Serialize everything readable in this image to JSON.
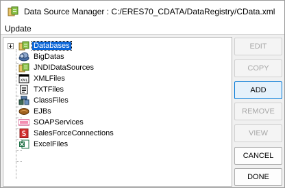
{
  "window": {
    "title": "Data Source Manager : C:/ERES70_CDATA/DataRegistry/CData.xml"
  },
  "menubar": {
    "items": [
      {
        "label": "Update"
      }
    ]
  },
  "tree": {
    "nodes": [
      {
        "label": "Databases",
        "icon": "database-folder-icon",
        "selected": true
      },
      {
        "label": "BigDatas",
        "icon": "bigdata-icon"
      },
      {
        "label": "JNDIDataSources",
        "icon": "jndi-folder-icon"
      },
      {
        "label": "XMLFiles",
        "icon": "xml-file-icon"
      },
      {
        "label": "TXTFiles",
        "icon": "text-file-icon"
      },
      {
        "label": "ClassFiles",
        "icon": "class-file-icon"
      },
      {
        "label": "EJBs",
        "icon": "ejb-bean-icon"
      },
      {
        "label": "SOAPServices",
        "icon": "soap-icon"
      },
      {
        "label": "SalesForceConnections",
        "icon": "salesforce-icon"
      },
      {
        "label": "ExcelFiles",
        "icon": "excel-icon"
      }
    ]
  },
  "buttons": {
    "edit": "EDIT",
    "copy": "COPY",
    "add": "ADD",
    "remove": "REMOVE",
    "view": "VIEW",
    "cancel": "CANCEL",
    "done": "DONE"
  },
  "colors": {
    "selection": "#0a64d6",
    "focus_border": "#0078d7"
  }
}
